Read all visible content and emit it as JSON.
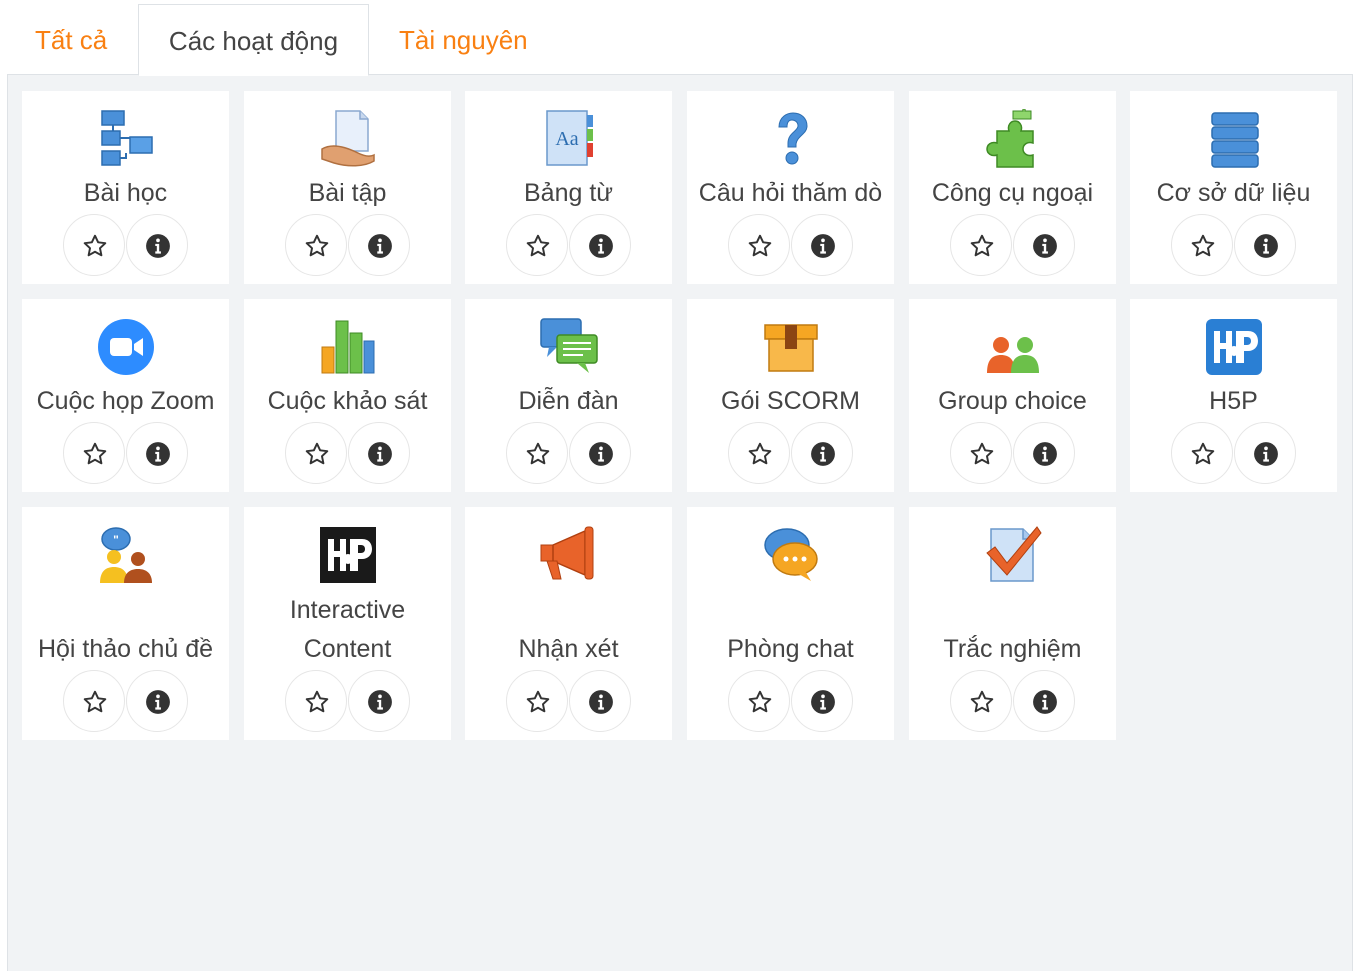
{
  "tabs": [
    {
      "label": "Tất cả",
      "active": false
    },
    {
      "label": "Các hoạt động",
      "active": true
    },
    {
      "label": "Tài nguyên",
      "active": false
    }
  ],
  "colors": {
    "accent": "#f98012",
    "panel_bg": "#f1f3f5",
    "card_bg": "#ffffff",
    "text": "#444444"
  },
  "items": [
    {
      "label": "Bài học",
      "icon": "lesson-icon"
    },
    {
      "label": "Bài tập",
      "icon": "assignment-icon"
    },
    {
      "label": "Bảng từ",
      "icon": "glossary-icon"
    },
    {
      "label": "Câu hỏi thăm dò",
      "icon": "choice-question-icon"
    },
    {
      "label": "Công cụ ngoại",
      "icon": "external-tool-icon"
    },
    {
      "label": "Cơ sở dữ liệu",
      "icon": "database-icon"
    },
    {
      "label": "Cuộc họp Zoom",
      "icon": "zoom-icon"
    },
    {
      "label": "Cuộc khảo sát",
      "icon": "survey-icon"
    },
    {
      "label": "Diễn đàn",
      "icon": "forum-icon"
    },
    {
      "label": "Gói SCORM",
      "icon": "scorm-icon"
    },
    {
      "label": "Group choice",
      "icon": "group-choice-icon"
    },
    {
      "label": "H5P",
      "icon": "h5p-icon"
    },
    {
      "label": "Hội thảo chủ đề",
      "icon": "workshop-icon"
    },
    {
      "label": "Interactive Content",
      "label_line1": "Interactive",
      "label_line2": "Content",
      "icon": "h5p-interactive-icon"
    },
    {
      "label": "Nhận xét",
      "icon": "feedback-icon"
    },
    {
      "label": "Phòng chat",
      "icon": "chat-icon"
    },
    {
      "label": "Trắc nghiệm",
      "icon": "quiz-icon"
    }
  ]
}
